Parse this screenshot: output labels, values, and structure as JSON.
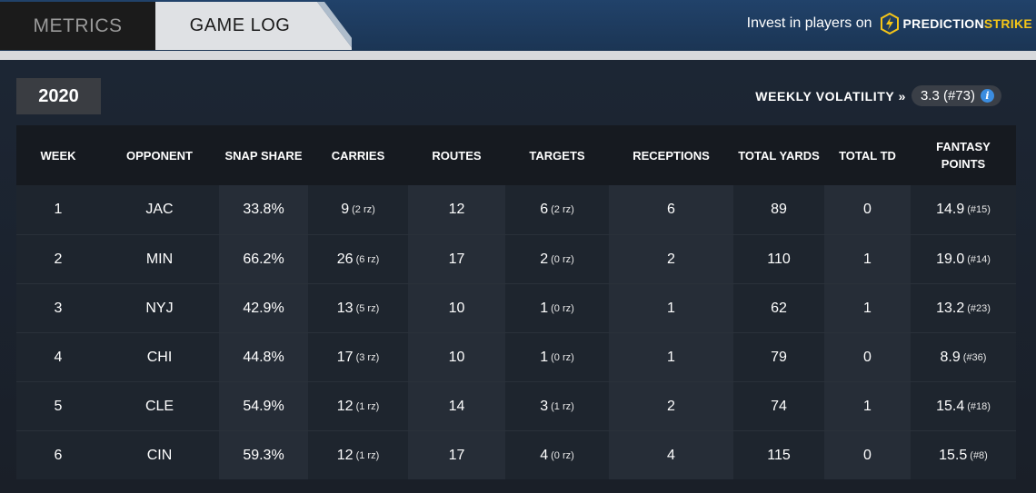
{
  "tabs": [
    {
      "label": "METRICS",
      "active": false
    },
    {
      "label": "GAME LOG",
      "active": true
    }
  ],
  "promo": {
    "text": "Invest in players on",
    "brand_part1": "PREDICTION",
    "brand_part2": "STRIKE",
    "brand_icon": "lightning-bolt-icon"
  },
  "season": "2020",
  "volatility": {
    "label": "WEEKLY VOLATILITY »",
    "value": "3.3 (#73)",
    "info_icon": "info-icon"
  },
  "table": {
    "headers": [
      "WEEK",
      "OPPONENT",
      "SNAP SHARE",
      "CARRIES",
      "ROUTES",
      "TARGETS",
      "RECEPTIONS",
      "TOTAL YARDS",
      "TOTAL TD",
      "FANTASY POINTS"
    ],
    "rows": [
      {
        "week": "1",
        "opponent": "JAC",
        "snap_share": "33.8%",
        "carries": "9",
        "carries_rz": "(2 rz)",
        "routes": "12",
        "targets": "6",
        "targets_rz": "(2 rz)",
        "receptions": "6",
        "total_yards": "89",
        "total_td": "0",
        "fantasy_points": "14.9",
        "fantasy_rank": "(#15)"
      },
      {
        "week": "2",
        "opponent": "MIN",
        "snap_share": "66.2%",
        "carries": "26",
        "carries_rz": "(6 rz)",
        "routes": "17",
        "targets": "2",
        "targets_rz": "(0 rz)",
        "receptions": "2",
        "total_yards": "110",
        "total_td": "1",
        "fantasy_points": "19.0",
        "fantasy_rank": "(#14)"
      },
      {
        "week": "3",
        "opponent": "NYJ",
        "snap_share": "42.9%",
        "carries": "13",
        "carries_rz": "(5 rz)",
        "routes": "10",
        "targets": "1",
        "targets_rz": "(0 rz)",
        "receptions": "1",
        "total_yards": "62",
        "total_td": "1",
        "fantasy_points": "13.2",
        "fantasy_rank": "(#23)"
      },
      {
        "week": "4",
        "opponent": "CHI",
        "snap_share": "44.8%",
        "carries": "17",
        "carries_rz": "(3 rz)",
        "routes": "10",
        "targets": "1",
        "targets_rz": "(0 rz)",
        "receptions": "1",
        "total_yards": "79",
        "total_td": "0",
        "fantasy_points": "8.9",
        "fantasy_rank": "(#36)"
      },
      {
        "week": "5",
        "opponent": "CLE",
        "snap_share": "54.9%",
        "carries": "12",
        "carries_rz": "(1 rz)",
        "routes": "14",
        "targets": "3",
        "targets_rz": "(1 rz)",
        "receptions": "2",
        "total_yards": "74",
        "total_td": "1",
        "fantasy_points": "15.4",
        "fantasy_rank": "(#18)"
      },
      {
        "week": "6",
        "opponent": "CIN",
        "snap_share": "59.3%",
        "carries": "12",
        "carries_rz": "(1 rz)",
        "routes": "17",
        "targets": "4",
        "targets_rz": "(0 rz)",
        "receptions": "4",
        "total_yards": "115",
        "total_td": "0",
        "fantasy_points": "15.5",
        "fantasy_rank": "(#8)"
      }
    ]
  },
  "colors": {
    "topbar": "#1f3a5a",
    "brand_accent": "#f5c518",
    "info_icon": "#3b8de0"
  }
}
